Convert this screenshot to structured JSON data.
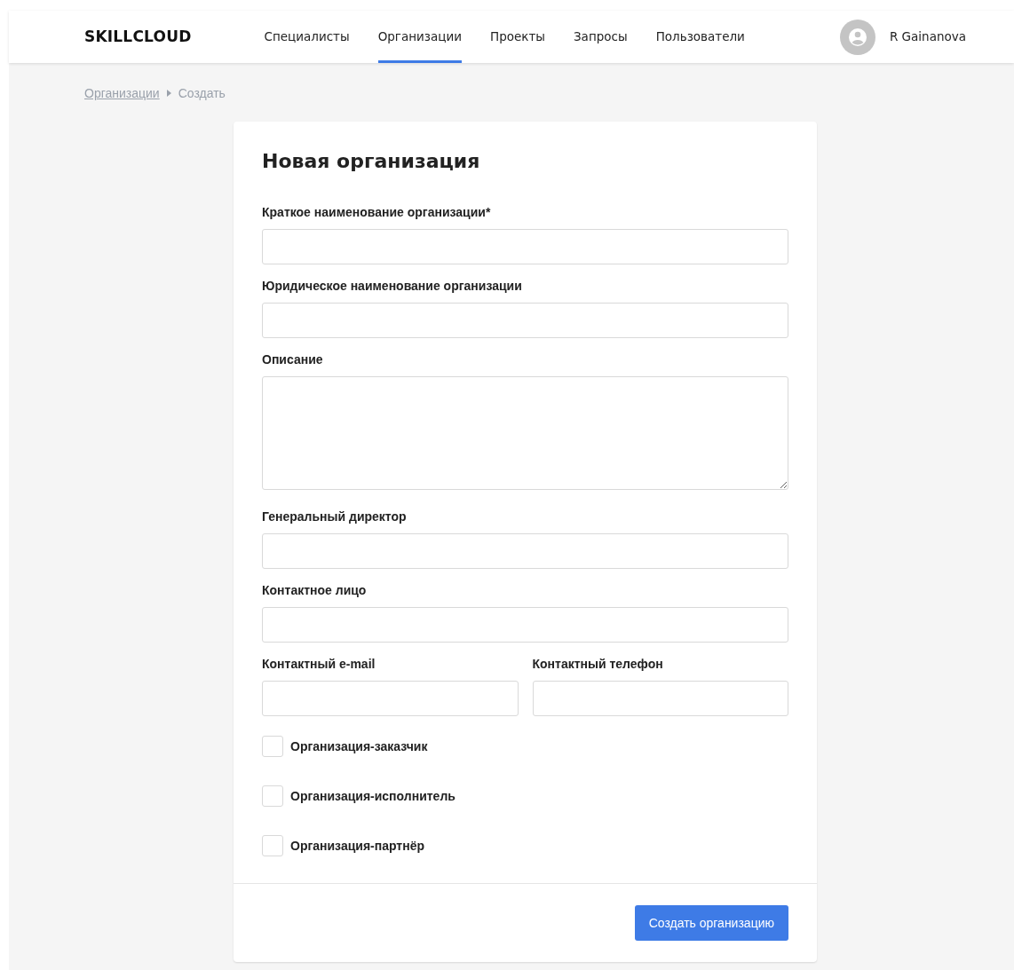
{
  "header": {
    "logo": "SKILLCLOUD",
    "nav": [
      {
        "label": "Специалисты",
        "selected": false
      },
      {
        "label": "Организации",
        "selected": true
      },
      {
        "label": "Проекты",
        "selected": false
      },
      {
        "label": "Запросы",
        "selected": false
      },
      {
        "label": "Пользователи",
        "selected": false
      }
    ],
    "user": "R Gainanova"
  },
  "breadcrumb": [
    {
      "label": "Организации",
      "kind": "link"
    },
    {
      "label": "Создать",
      "kind": "current"
    }
  ],
  "form": {
    "title": "Новая организация",
    "rows": [
      [
        {
          "label": "Краткое наименование организации*",
          "kind": "input"
        }
      ],
      [
        {
          "label": "Юридическое наименование организации",
          "kind": "input"
        }
      ],
      [
        {
          "label": "Описание",
          "kind": "textarea"
        }
      ],
      [
        {
          "label": "Генеральный директор",
          "kind": "input"
        }
      ],
      [
        {
          "label": "Контактное лицо",
          "kind": "input"
        }
      ],
      [
        {
          "label": "Контактный e-mail",
          "kind": "input"
        },
        {
          "label": "Контактный телефон",
          "kind": "input"
        }
      ]
    ],
    "checkboxes": [
      {
        "label": "Организация-заказчик",
        "checked": false
      },
      {
        "label": "Организация-исполнитель",
        "checked": false
      },
      {
        "label": "Организация-партнёр",
        "checked": false
      }
    ],
    "submit": "Создать организацию"
  }
}
